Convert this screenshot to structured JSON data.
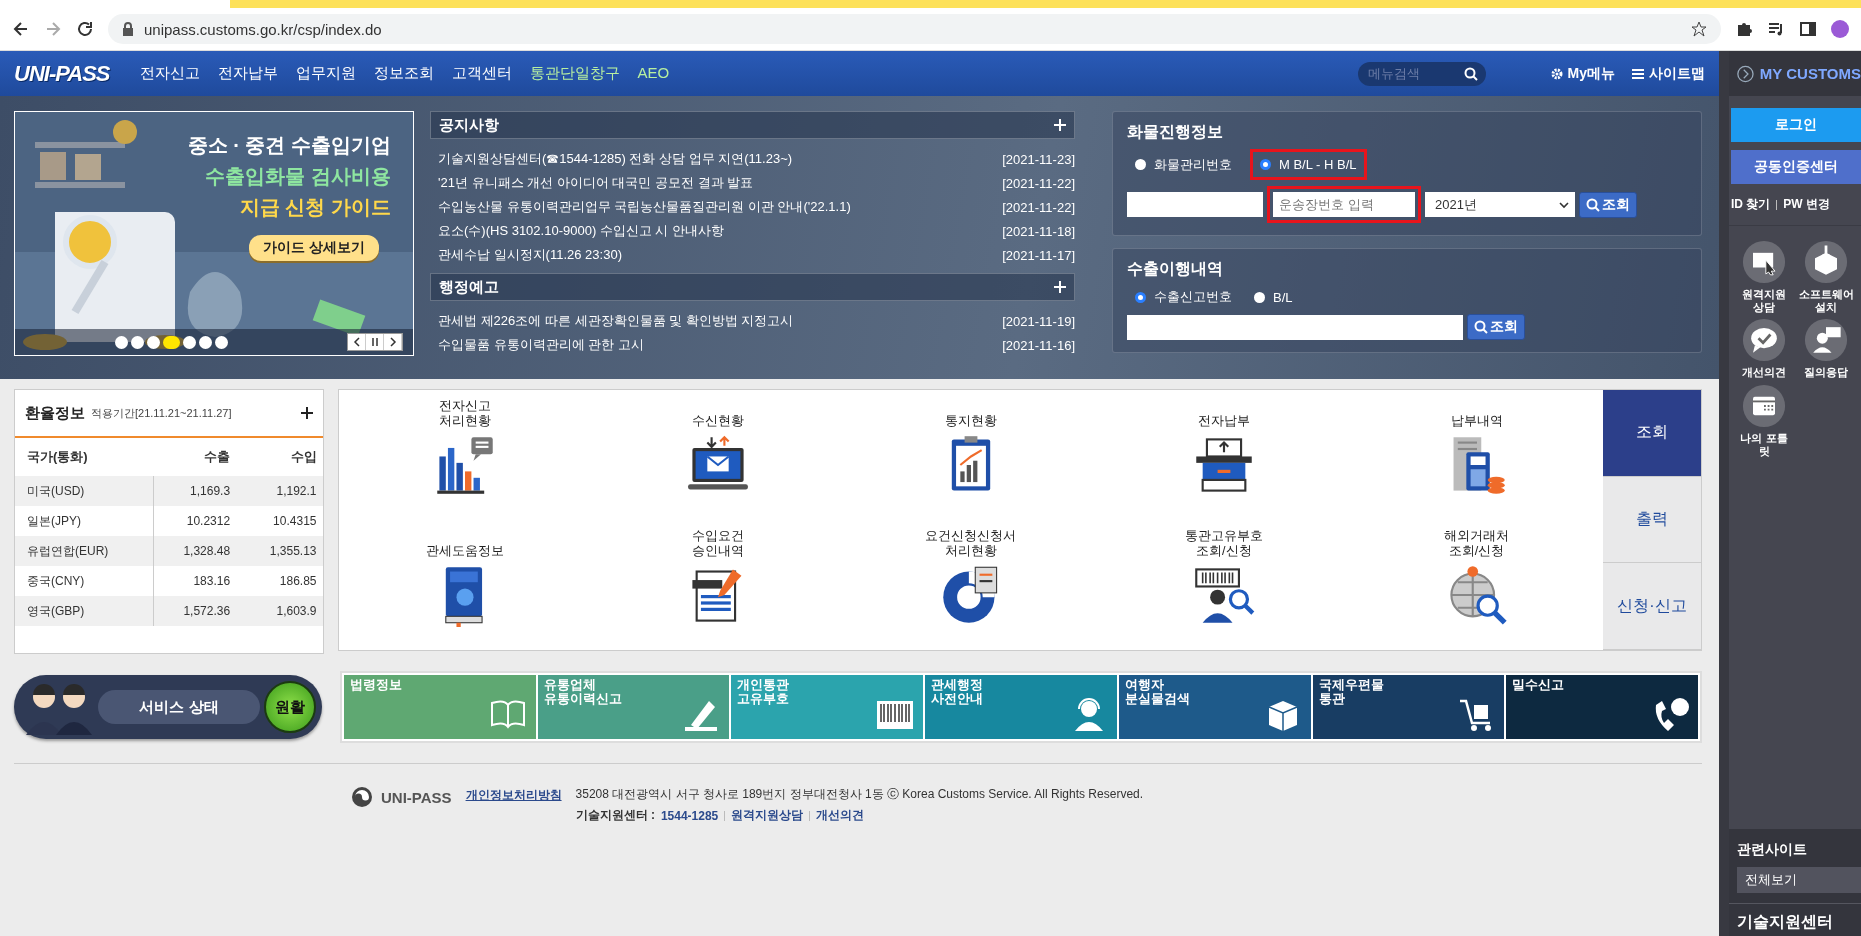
{
  "browser": {
    "url": "unipass.customs.go.kr/csp/index.do"
  },
  "header": {
    "logo": "UNI-PASS",
    "menu": [
      {
        "label": "전자신고",
        "kind": "main"
      },
      {
        "label": "전자납부",
        "kind": "main"
      },
      {
        "label": "업무지원",
        "kind": "main"
      },
      {
        "label": "정보조회",
        "kind": "main"
      },
      {
        "label": "고객센터",
        "kind": "main"
      },
      {
        "label": "통관단일창구",
        "kind": "accent"
      },
      {
        "label": "AEO",
        "kind": "accent"
      }
    ],
    "search": {
      "placeholder": "메뉴검색"
    },
    "my_menu": "My메뉴",
    "sitemap": "사이트맵"
  },
  "banner": {
    "lines": [
      {
        "text": "중소 · 중견 수출입기업",
        "color": "#ffffff"
      },
      {
        "text": "수출입화물 검사비용",
        "color": "#8ee6a0"
      },
      {
        "text": "지급 신청 가이드",
        "color": "#ffd84a"
      }
    ],
    "button": "가이드 상세보기",
    "dots": [
      {
        "selected": false
      },
      {
        "selected": false
      },
      {
        "selected": false
      },
      {
        "selected": true
      },
      {
        "selected": false
      },
      {
        "selected": false
      },
      {
        "selected": false
      }
    ]
  },
  "notices": [
    {
      "title": "공지사항",
      "items": [
        {
          "text": "기술지원상담센터(☎1544-1285) 전화 상담 업무 지연(11.23~)",
          "date": "[2021-11-23]"
        },
        {
          "text": "'21년 유니패스 개선 아이디어 대국민 공모전 결과 발표",
          "date": "[2021-11-22]"
        },
        {
          "text": "수입농산물 유통이력관리업무 국립농산물품질관리원 이관 안내('22.1.1)",
          "date": "[2021-11-22]"
        },
        {
          "text": "요소(수)(HS 3102.10-9000) 수입신고 시 안내사항",
          "date": "[2021-11-18]"
        },
        {
          "text": "관세수납 일시정지(11.26 23:30)",
          "date": "[2021-11-17]"
        }
      ]
    },
    {
      "title": "행정예고",
      "items": [
        {
          "text": "관세법 제226조에 따른 세관장확인물품 및 확인방법 지정고시",
          "date": "[2021-11-19]"
        },
        {
          "text": "수입물품 유통이력관리에 관한 고시",
          "date": "[2021-11-16]"
        }
      ]
    }
  ],
  "cargo": {
    "title": "화물진행정보",
    "options": [
      {
        "label": "화물관리번호",
        "selected": false,
        "highlighted": false
      },
      {
        "label": "M B/L - H B/L",
        "selected": true,
        "highlighted": true
      }
    ],
    "waybill": {
      "placeholder": "운송장번호 입력",
      "highlighted": true
    },
    "year": "2021년",
    "button": "조회"
  },
  "export": {
    "title": "수출이행내역",
    "options": [
      {
        "label": "수출신고번호",
        "selected": true
      },
      {
        "label": "B/L",
        "selected": false
      }
    ],
    "button": "조회"
  },
  "exchange": {
    "title": "환율정보",
    "period": "적용기간[21.11.21~21.11.27]",
    "columns": [
      "국가(통화)",
      "수출",
      "수입"
    ],
    "rows": [
      [
        "미국(USD)",
        "1,169.3",
        "1,192.1"
      ],
      [
        "일본(JPY)",
        "10.2312",
        "10.4315"
      ],
      [
        "유럽연합(EUR)",
        "1,328.48",
        "1,355.13"
      ],
      [
        "중국(CNY)",
        "183.16",
        "186.85"
      ],
      [
        "영국(GBP)",
        "1,572.36",
        "1,603.9"
      ]
    ]
  },
  "services": {
    "items": [
      "전자신고\n처리현황",
      "수신현황",
      "통지현황",
      "전자납부",
      "납부내역",
      "관세도움정보",
      "수입요건\n승인내역",
      "요건신청신청서\n처리현황",
      "통관고유부호\n조회/신청",
      "해외거래처\n조회/신청"
    ],
    "tabs": [
      {
        "label": "조회",
        "selected": true
      },
      {
        "label": "출력",
        "selected": false
      },
      {
        "label": "신청·신고",
        "selected": false
      }
    ]
  },
  "service_status": {
    "label": "서비스 상태",
    "status": "원활"
  },
  "tiles": [
    {
      "label": "법령정보",
      "color": "#5fa872"
    },
    {
      "label": "유통업체\n유통이력신고",
      "color": "#4a9f88"
    },
    {
      "label": "개인통관\n고유부호",
      "color": "#2ba4ad"
    },
    {
      "label": "관세행정\n사전안내",
      "color": "#17889f"
    },
    {
      "label": "여행자\n분실물검색",
      "color": "#1e5a8a"
    },
    {
      "label": "국제우편물\n통관",
      "color": "#183d63"
    },
    {
      "label": "밀수신고",
      "color": "#0d2940"
    }
  ],
  "footer": {
    "logo": "UNI-PASS",
    "privacy": "개인정보처리방침",
    "address": "35208 대전광역시 서구 청사로 189번지 정부대전청사 1동 ⓒ Korea Customs Service. All Rights Reserved.",
    "support_label": "기술지원센터 :",
    "support_phone": "1544-1285",
    "links": [
      "원격지원상담",
      "개선의견"
    ]
  },
  "sidebar": {
    "title": "MY CUSTOMS",
    "login": "로그인",
    "cert": "공동인증센터",
    "links": [
      "ID 찾기",
      "PW 변경"
    ],
    "shortcuts": [
      "원격지원\n상담",
      "소프트웨어\n설치",
      "개선의견",
      "질의응답",
      "나의 포틀\n릿"
    ],
    "related_title": "관련사이트",
    "related_select": "전체보기",
    "support_title": "기술지원센터"
  }
}
